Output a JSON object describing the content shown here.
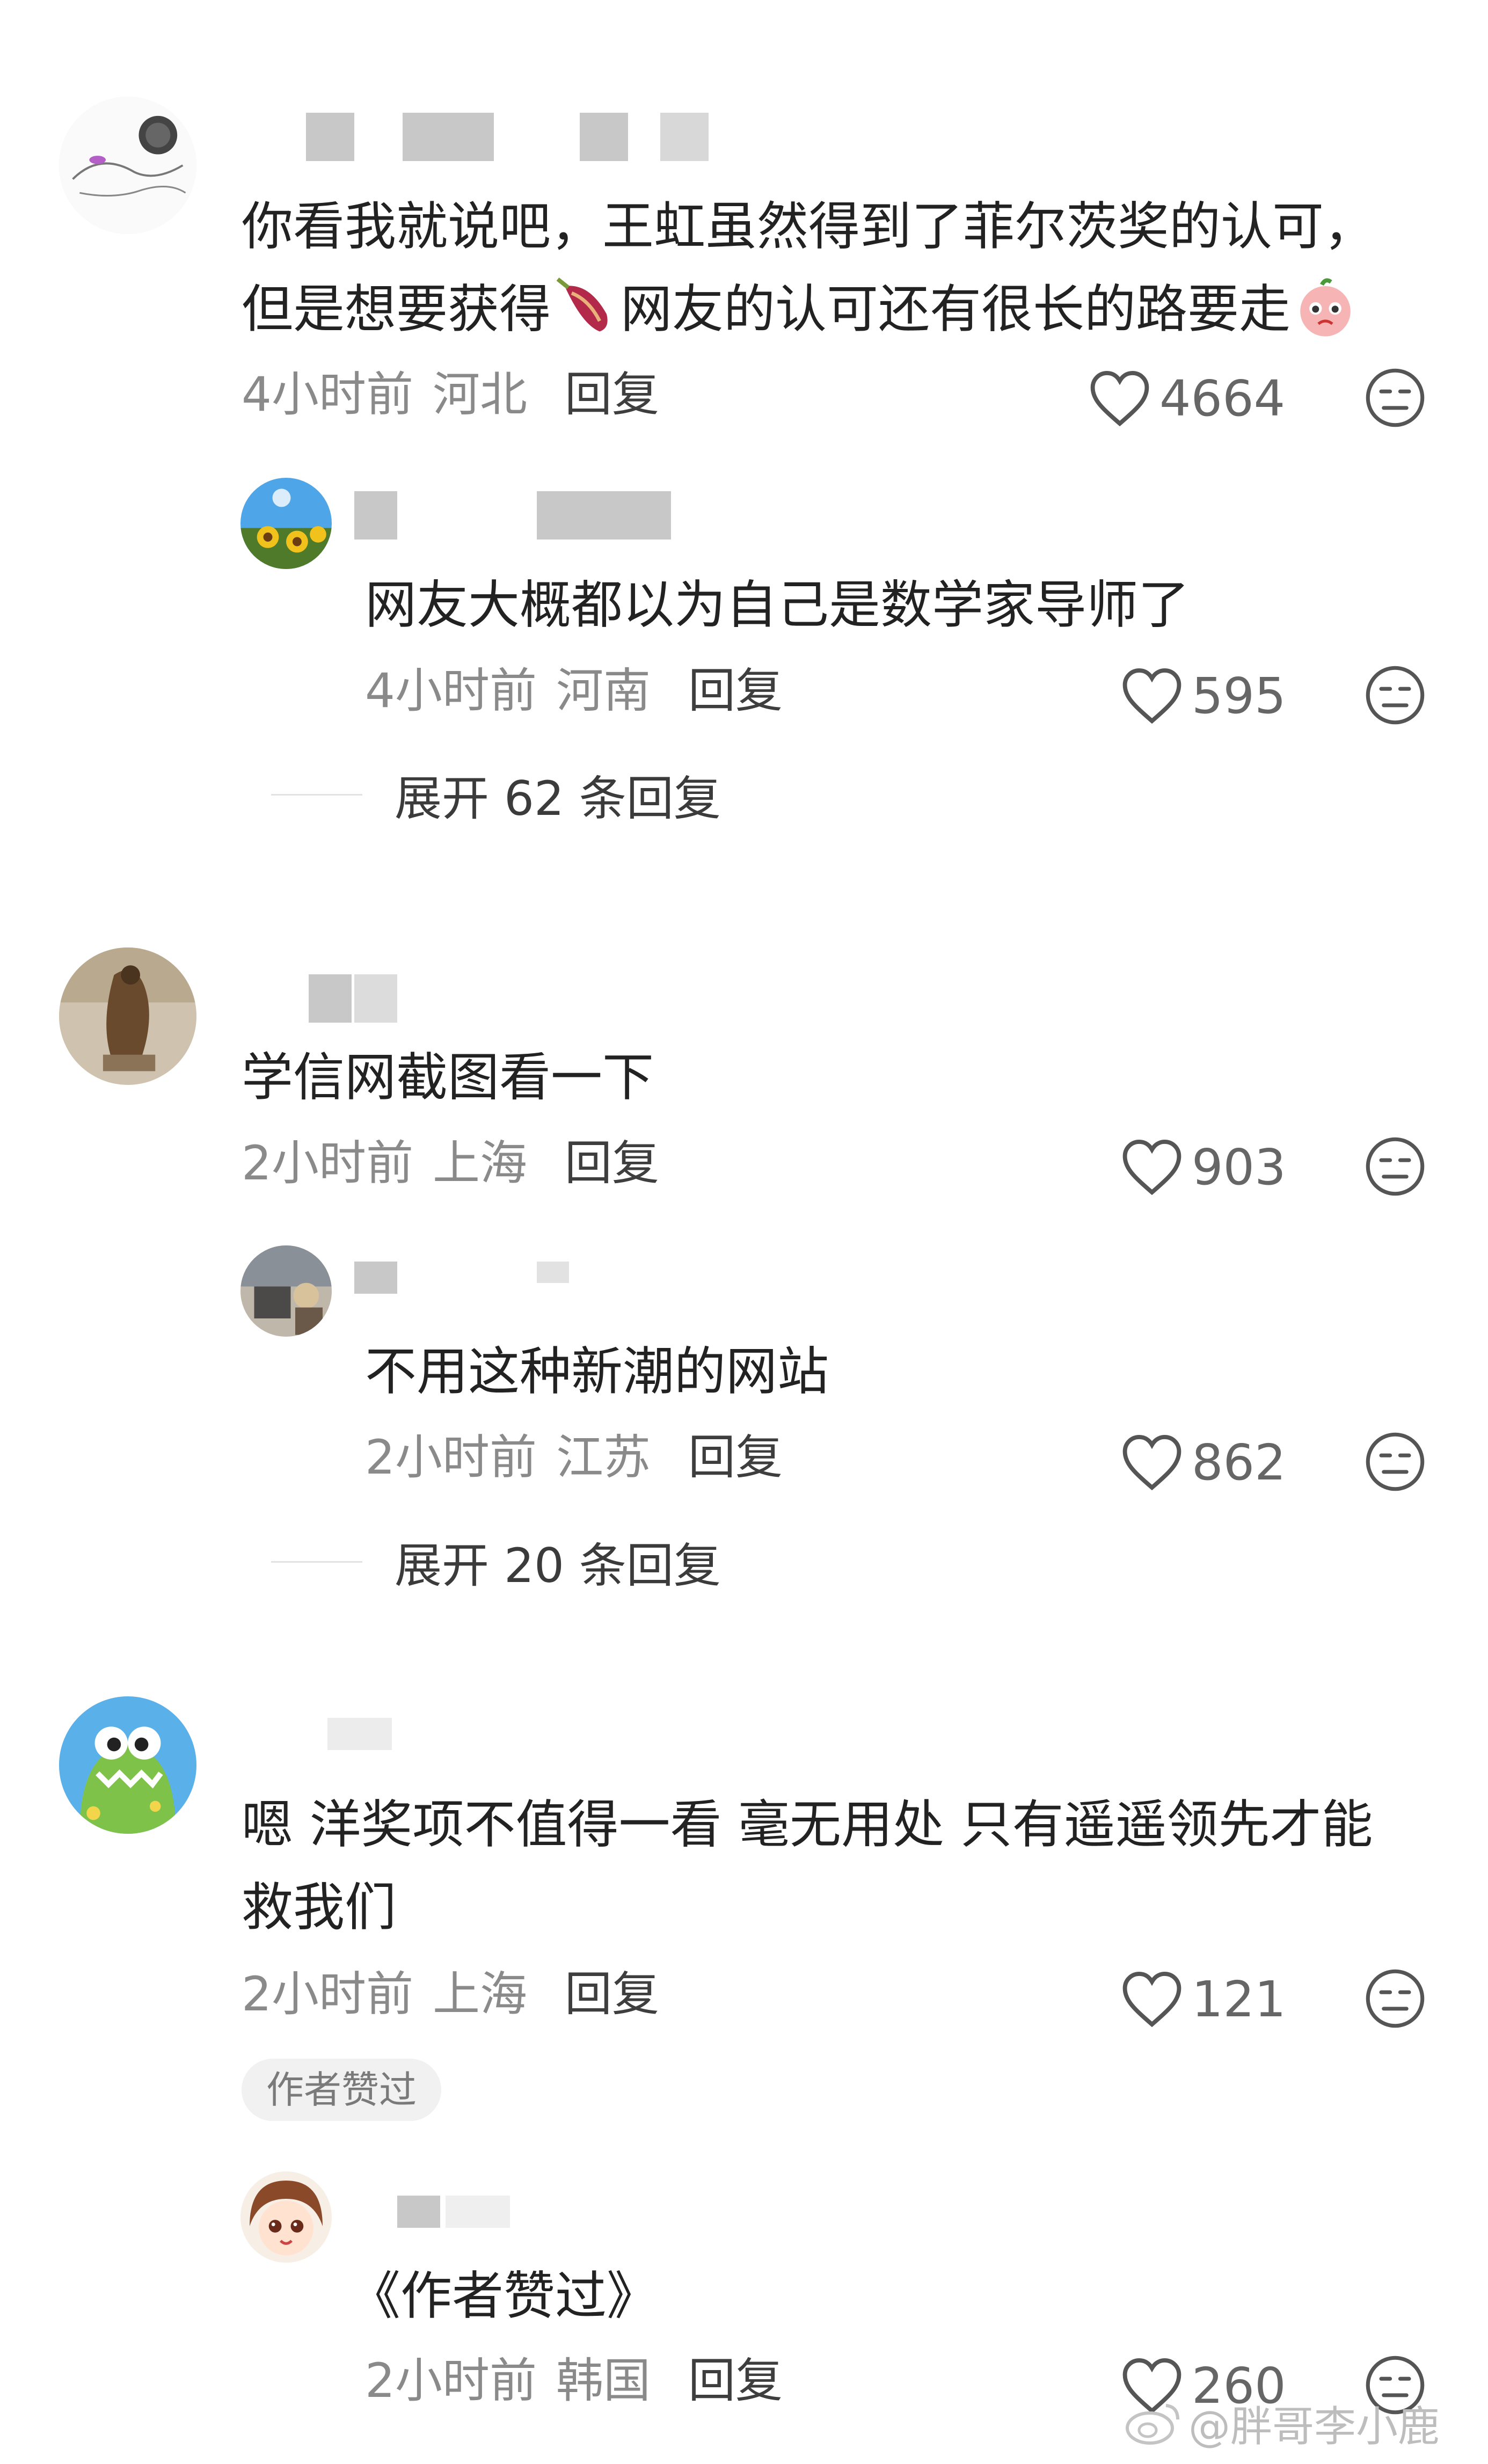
{
  "comments": [
    {
      "avatar": "sketch-avatar",
      "text_line1": "你看我就说吧，王虹虽然得到了菲尔茨奖的认可，",
      "text_line2_part1": "但是想要获得",
      "text_line2_part2": "网友的认可还有很长的路要走",
      "emoji1": "sweet-potato-emoji",
      "emoji2": "crying-peach-emoji",
      "time": "4小时前",
      "location": "河北",
      "reply_label": "回复",
      "likes": "4664",
      "replies": [
        {
          "avatar": "sunflower-avatar",
          "text": "网友大概都以为自己是数学家导师了",
          "time": "4小时前",
          "location": "河南",
          "reply_label": "回复",
          "likes": "595"
        }
      ],
      "expand_label": "展开 62 条回复"
    },
    {
      "avatar": "statue-avatar",
      "text": "学信网截图看一下",
      "time": "2小时前",
      "location": "上海",
      "reply_label": "回复",
      "likes": "903",
      "replies": [
        {
          "avatar": "room-photo-avatar",
          "text": "不用这种新潮的网站",
          "time": "2小时前",
          "location": "江苏",
          "reply_label": "回复",
          "likes": "862"
        }
      ],
      "expand_label": "展开 20 条回复"
    },
    {
      "avatar": "dinosaur-avatar",
      "text_line1": "嗯 洋奖项不值得一看 毫无用处 只有遥遥领先才能",
      "text_line2": "救我们",
      "time": "2小时前",
      "location": "上海",
      "reply_label": "回复",
      "likes": "121",
      "badge": "作者赞过",
      "replies": [
        {
          "avatar": "anime-girl-avatar",
          "text": "《作者赞过》",
          "time": "2小时前",
          "location": "韩国",
          "reply_label": "回复",
          "likes": "260"
        }
      ]
    }
  ],
  "watermark": "@胖哥李小鹿",
  "colors": {
    "text": "#222222",
    "meta": "#8a8a8a",
    "blur": "#c8c8c8",
    "badge_bg": "#f1f1f1"
  }
}
